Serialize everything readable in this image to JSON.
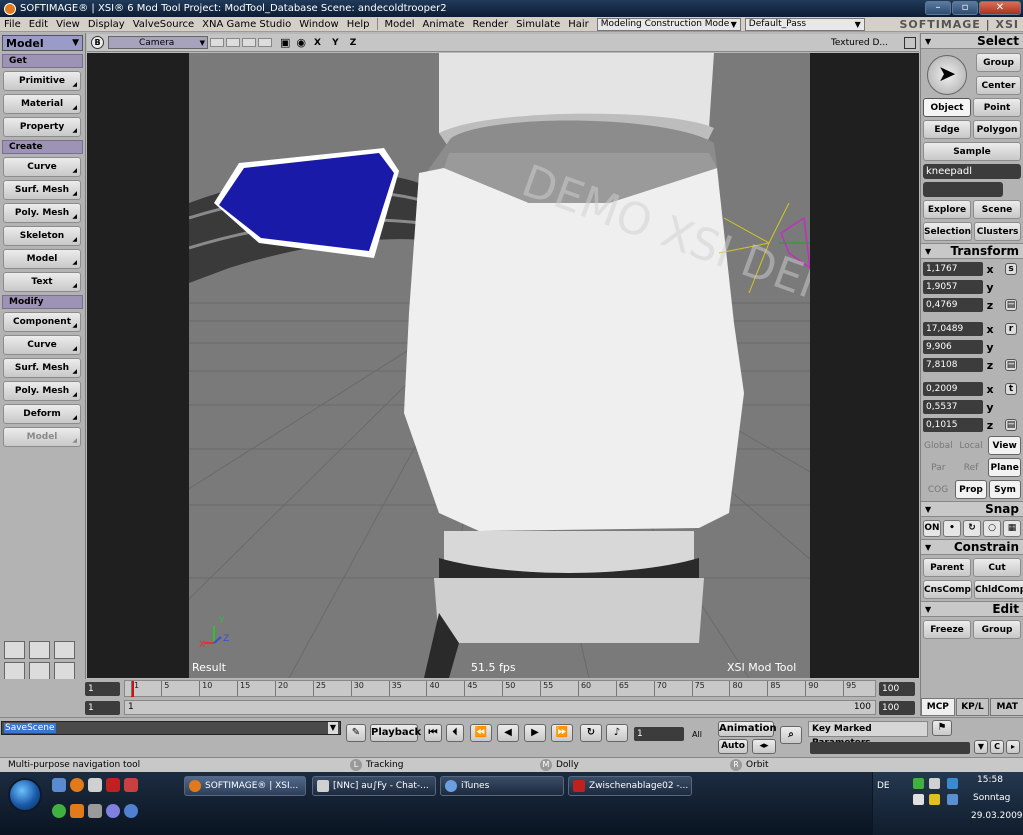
{
  "titlebar": {
    "title": "SOFTIMAGE® | XSI® 6 Mod Tool Project: ModTool_Database    Scene: andecoldtrooper2"
  },
  "menubar": {
    "items": [
      "File",
      "Edit",
      "View",
      "Display",
      "ValveSource",
      "XNA Game Studio",
      "Window",
      "Help",
      "Model",
      "Animate",
      "Render",
      "Simulate",
      "Hair"
    ],
    "mode_combo": "Modeling Construction Mode",
    "pass_combo": "Default_Pass",
    "logo": "SOFTIMAGE | XSI"
  },
  "left_panel": {
    "mode": "Model",
    "sections": {
      "get": "Get",
      "create": "Create",
      "modify": "Modify"
    },
    "get_buttons": [
      "Primitive",
      "Material",
      "Property"
    ],
    "create_buttons": [
      "Curve",
      "Surf. Mesh",
      "Poly. Mesh",
      "Skeleton",
      "Model",
      "Text"
    ],
    "modify_buttons": [
      "Component",
      "Curve",
      "Surf. Mesh",
      "Poly. Mesh",
      "Deform",
      "Model"
    ]
  },
  "viewport": {
    "header_b": "B",
    "camera": "Camera",
    "axes": "X Y Z",
    "display_mode": "Textured D...",
    "result_label": "Result",
    "fps_label": "51.5  fps",
    "tool_label": "XSI Mod Tool",
    "watermark": "DEMO XSI DEMO XSI DEMO XSI",
    "axis_y": "Y",
    "axis_x": "X",
    "axis_z": "Z"
  },
  "right_panel": {
    "select_title": "Select",
    "group": "Group",
    "center": "Center",
    "object": "Object",
    "point": "Point",
    "edge": "Edge",
    "polygon": "Polygon",
    "sample": "Sample",
    "name_field": "kneepadl",
    "explore": "Explore",
    "scene": "Scene",
    "selection": "Selection",
    "clusters": "Clusters",
    "transform_title": "Transform",
    "scale": [
      "1,1767",
      "1,9057",
      "0,4769"
    ],
    "rotate": [
      "17,0489",
      "9,906",
      "7,8108"
    ],
    "translate": [
      "0,2009",
      "0,5537",
      "0,1015"
    ],
    "axes": [
      "x",
      "y",
      "z"
    ],
    "icons": {
      "scale": "s",
      "rotate": "r",
      "translate": "t"
    },
    "space": [
      "Global",
      "Local",
      "View"
    ],
    "space2": [
      "Par",
      "Ref",
      "Plane"
    ],
    "space3": [
      "COG",
      "Prop",
      "Sym"
    ],
    "snap_title": "Snap",
    "snap_on": "ON",
    "constrain_title": "Constrain",
    "parent": "Parent",
    "cut": "Cut",
    "cnscomp": "CnsComp",
    "chldcomp": "ChldComp",
    "edit_title": "Edit",
    "freeze": "Freeze",
    "group2": "Group",
    "tabs": [
      "MCP",
      "KP/L",
      "MAT"
    ]
  },
  "timeline": {
    "start_top": "1",
    "start_bottom": "1",
    "current": "1",
    "end_top": "100",
    "end_bottom": "100",
    "end_range": "100",
    "ticks": [
      "1",
      "5",
      "10",
      "15",
      "20",
      "25",
      "30",
      "35",
      "40",
      "45",
      "50",
      "55",
      "60",
      "65",
      "70",
      "75",
      "80",
      "85",
      "90",
      "95"
    ]
  },
  "command_row": {
    "script_value": "SaveScene",
    "playback": "Playback",
    "frame": "1",
    "all": "All",
    "animation": "Animation",
    "auto": "Auto",
    "key_marked": "Key Marked Parameters"
  },
  "statusbar": {
    "message": "Multi-purpose navigation tool",
    "l_key": "L",
    "l_label": "Tracking",
    "m_key": "M",
    "m_label": "Dolly",
    "r_key": "R",
    "r_label": "Orbit"
  },
  "taskbar": {
    "tasks": [
      "SOFTIMAGE® | XSI...",
      "[NNc] au∫Fy - Chat-...",
      "iTunes",
      "Zwischenablage02 -..."
    ],
    "lang": "DE",
    "time": "15:58",
    "day": "Sonntag",
    "date": "29.03.2009"
  },
  "colors": {
    "section_purple": "#9d93b4",
    "mode_blue": "#9b9bc8",
    "kneepad_blue": "#1a1aa8",
    "timeline_cursor": "#d01010"
  }
}
